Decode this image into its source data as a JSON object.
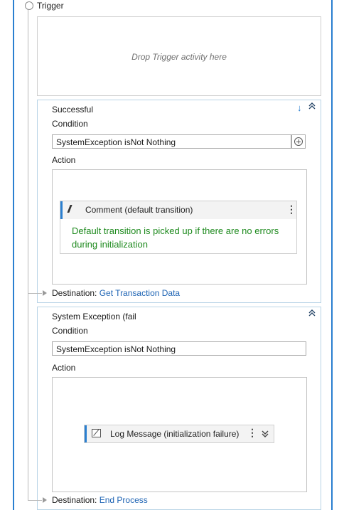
{
  "trigger": {
    "label": "Trigger",
    "drop_hint": "Drop Trigger activity here"
  },
  "transitions": [
    {
      "title": "Successful",
      "condition_label": "Condition",
      "condition_value": "SystemException isNot Nothing",
      "action_label": "Action",
      "comment": {
        "title": "Comment (default transition)",
        "body": "Default transition is picked up if there are no errors during initialization"
      },
      "destination_label": "Destination:",
      "destination_value": "Get Transaction Data"
    },
    {
      "title": "System Exception (fail",
      "condition_label": "Condition",
      "condition_value": "SystemException isNot Nothing",
      "action_label": "Action",
      "activity": {
        "title": "Log Message (initialization failure)"
      },
      "destination_label": "Destination:",
      "destination_value": "End Process"
    }
  ],
  "icons": {
    "collapse": "chevron-double-up",
    "expand": "chevron-double-down",
    "move_down": "arrow-down",
    "add": "plus-circle",
    "menu": "kebab-vertical"
  },
  "colors": {
    "accent": "#2a7fd0",
    "comment_text": "#1e8a1e",
    "link": "#1e64b4"
  }
}
